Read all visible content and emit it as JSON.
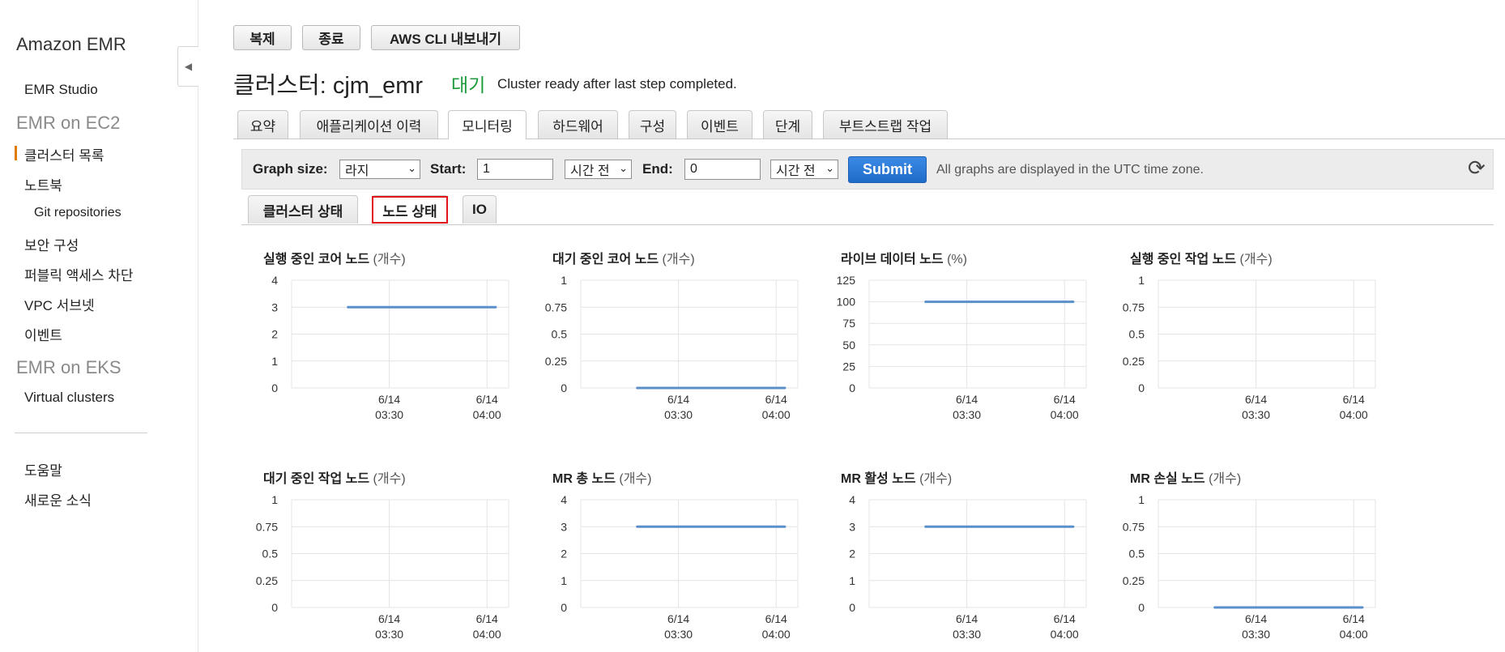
{
  "sidebar": {
    "brand": "Amazon EMR",
    "items": [
      {
        "label": "EMR Studio",
        "kind": "item"
      },
      {
        "label": "EMR on EC2",
        "kind": "section"
      },
      {
        "label": "클러스터 목록",
        "kind": "item",
        "active": true
      },
      {
        "label": "노트북",
        "kind": "item"
      },
      {
        "label": "Git repositories",
        "kind": "sub"
      },
      {
        "label": "보안 구성",
        "kind": "item"
      },
      {
        "label": "퍼블릭 액세스 차단",
        "kind": "item"
      },
      {
        "label": "VPC 서브넷",
        "kind": "item"
      },
      {
        "label": "이벤트",
        "kind": "item"
      },
      {
        "label": "EMR on EKS",
        "kind": "section"
      },
      {
        "label": "Virtual clusters",
        "kind": "item"
      },
      {
        "label": "도움말",
        "kind": "item"
      },
      {
        "label": "새로운 소식",
        "kind": "item"
      }
    ],
    "collapse_icon": "chevron-left-icon"
  },
  "actions": {
    "clone": "복제",
    "terminate": "종료",
    "export_cli": "AWS CLI 내보내기"
  },
  "cluster": {
    "title": "클러스터: cjm_emr",
    "status": "대기",
    "status_color": "#1d9b3b",
    "status_message": "Cluster ready after last step completed."
  },
  "tabs": [
    "요약",
    "애플리케이션 이력",
    "모니터링",
    "하드웨어",
    "구성",
    "이벤트",
    "단계",
    "부트스트랩 작업"
  ],
  "active_tab": "모니터링",
  "toolbar": {
    "graph_size_label": "Graph size:",
    "graph_size_value": "라지",
    "start_label": "Start:",
    "start_value": "1",
    "start_unit": "시간 전",
    "end_label": "End:",
    "end_value": "0",
    "end_unit": "시간 전",
    "submit": "Submit",
    "note": "All graphs are displayed in the UTC time zone.",
    "refresh_icon": "refresh-icon"
  },
  "subtabs": [
    "클러스터 상태",
    "노드 상태",
    "IO"
  ],
  "active_subtab": "노드 상태",
  "chart_data": [
    {
      "type": "line",
      "title": "실행 중인 코어 노드",
      "unit": "(개수)",
      "yticks": [
        "0",
        "1",
        "2",
        "3",
        "4"
      ],
      "ylim": [
        0,
        4
      ],
      "xticks": [
        [
          "6/14",
          "03:30"
        ],
        [
          "6/14",
          "04:00"
        ]
      ],
      "series": [
        {
          "x": [
            0.26,
            0.94
          ],
          "values": [
            3,
            3
          ]
        }
      ],
      "color": "#5b8fc9"
    },
    {
      "type": "line",
      "title": "대기 중인 코어 노드",
      "unit": "(개수)",
      "yticks": [
        "0",
        "0.25",
        "0.5",
        "0.75",
        "1"
      ],
      "ylim": [
        0,
        1
      ],
      "xticks": [
        [
          "6/14",
          "03:30"
        ],
        [
          "6/14",
          "04:00"
        ]
      ],
      "series": [
        {
          "x": [
            0.26,
            0.94
          ],
          "values": [
            0,
            0
          ]
        }
      ],
      "color": "#5b8fc9"
    },
    {
      "type": "line",
      "title": "라이브 데이터 노드",
      "unit": "(%)",
      "yticks": [
        "0",
        "25",
        "50",
        "75",
        "100",
        "125"
      ],
      "ylim": [
        0,
        125
      ],
      "xticks": [
        [
          "6/14",
          "03:30"
        ],
        [
          "6/14",
          "04:00"
        ]
      ],
      "series": [
        {
          "x": [
            0.26,
            0.94
          ],
          "values": [
            100,
            100
          ]
        }
      ],
      "color": "#5b8fc9"
    },
    {
      "type": "line",
      "title": "실행 중인 작업 노드",
      "unit": "(개수)",
      "yticks": [
        "0",
        "0.25",
        "0.5",
        "0.75",
        "1"
      ],
      "ylim": [
        0,
        1
      ],
      "xticks": [
        [
          "6/14",
          "03:30"
        ],
        [
          "6/14",
          "04:00"
        ]
      ],
      "series": [],
      "color": "#5b8fc9"
    },
    {
      "type": "line",
      "title": "대기 중인 작업 노드",
      "unit": "(개수)",
      "yticks": [
        "0",
        "0.25",
        "0.5",
        "0.75",
        "1"
      ],
      "ylim": [
        0,
        1
      ],
      "xticks": [
        [
          "6/14",
          "03:30"
        ],
        [
          "6/14",
          "04:00"
        ]
      ],
      "series": [],
      "color": "#5b8fc9"
    },
    {
      "type": "line",
      "title": "MR 총 노드",
      "unit": "(개수)",
      "yticks": [
        "0",
        "1",
        "2",
        "3",
        "4"
      ],
      "ylim": [
        0,
        4
      ],
      "xticks": [
        [
          "6/14",
          "03:30"
        ],
        [
          "6/14",
          "04:00"
        ]
      ],
      "series": [
        {
          "x": [
            0.26,
            0.94
          ],
          "values": [
            3,
            3
          ]
        }
      ],
      "color": "#5b8fc9"
    },
    {
      "type": "line",
      "title": "MR 활성 노드",
      "unit": "(개수)",
      "yticks": [
        "0",
        "1",
        "2",
        "3",
        "4"
      ],
      "ylim": [
        0,
        4
      ],
      "xticks": [
        [
          "6/14",
          "03:30"
        ],
        [
          "6/14",
          "04:00"
        ]
      ],
      "series": [
        {
          "x": [
            0.26,
            0.94
          ],
          "values": [
            3,
            3
          ]
        }
      ],
      "color": "#5b8fc9"
    },
    {
      "type": "line",
      "title": "MR 손실 노드",
      "unit": "(개수)",
      "yticks": [
        "0",
        "0.25",
        "0.5",
        "0.75",
        "1"
      ],
      "ylim": [
        0,
        1
      ],
      "xticks": [
        [
          "6/14",
          "03:30"
        ],
        [
          "6/14",
          "04:00"
        ]
      ],
      "series": [
        {
          "x": [
            0.26,
            0.94
          ],
          "values": [
            0,
            0
          ]
        }
      ],
      "color": "#5b8fc9"
    }
  ]
}
